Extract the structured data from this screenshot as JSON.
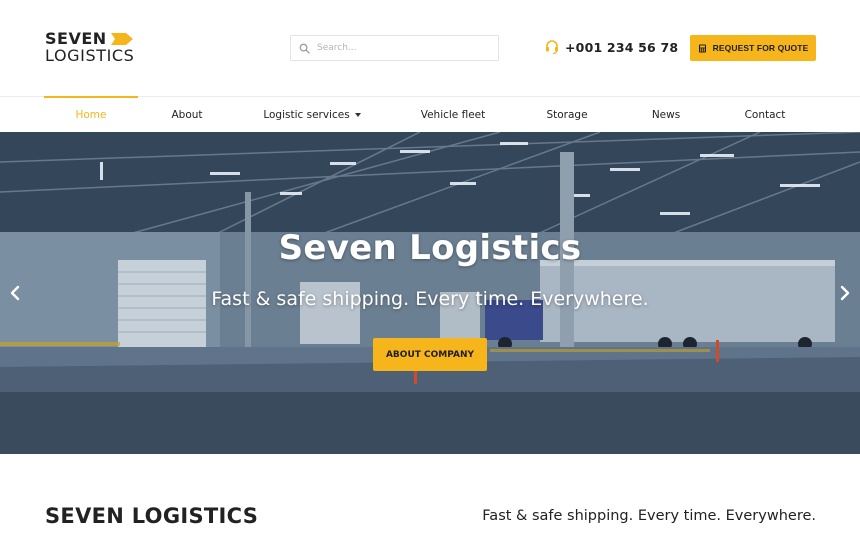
{
  "header": {
    "logo_top": "SEVEN",
    "logo_bottom": "LOGISTICS",
    "search_placeholder": "Search...",
    "phone": "+001 234 56 78",
    "quote_label": "REQUEST FOR QUOTE"
  },
  "nav": {
    "items": [
      {
        "label": "Home",
        "active": true
      },
      {
        "label": "About"
      },
      {
        "label": "Logistic services",
        "has_dropdown": true
      },
      {
        "label": "Vehicle fleet"
      },
      {
        "label": "Storage"
      },
      {
        "label": "News"
      },
      {
        "label": "Contact"
      }
    ]
  },
  "hero": {
    "title": "Seven Logistics",
    "subtitle": "Fast & safe shipping. Every time. Everywhere.",
    "button_label": "ABOUT COMPANY"
  },
  "section": {
    "title": "SEVEN LOGISTICS",
    "tagline": "Fast & safe shipping. Every time. Everywhere."
  },
  "colors": {
    "accent": "#f7b51c",
    "text": "#222222"
  },
  "icons": {
    "search": "search-icon",
    "phone": "headset-icon",
    "quote": "calculator-icon",
    "prev": "chevron-left-icon",
    "next": "chevron-right-icon"
  }
}
